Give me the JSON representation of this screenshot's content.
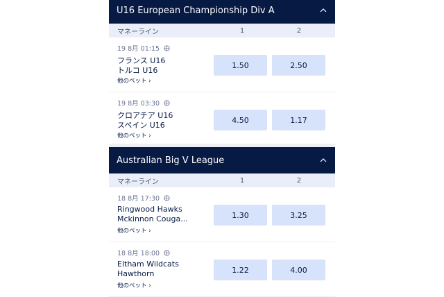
{
  "leagues": [
    {
      "title": "U16 European Championship Div A",
      "market_label": "マネーライン",
      "col1": "1",
      "col2": "2",
      "matches": [
        {
          "time": "19 8月 01:15",
          "team1": "フランス U16",
          "team2": "トルコ U16",
          "odd1": "1.50",
          "odd2": "2.50",
          "more": "他のベット ›"
        },
        {
          "time": "19 8月 03:30",
          "team1": "クロアチア U16",
          "team2": "スペイン U16",
          "odd1": "4.50",
          "odd2": "1.17",
          "more": "他のベット ›"
        }
      ]
    },
    {
      "title": "Australian Big V League",
      "market_label": "マネーライン",
      "col1": "1",
      "col2": "2",
      "matches": [
        {
          "time": "18 8月 17:30",
          "team1": "Ringwood Hawks",
          "team2": "Mckinnon Couga...",
          "odd1": "1.30",
          "odd2": "3.25",
          "more": "他のベット ›"
        },
        {
          "time": "18 8月 18:00",
          "team1": "Eltham Wildcats",
          "team2": "Hawthorn",
          "odd1": "1.22",
          "odd2": "4.00",
          "more": "他のベット ›"
        }
      ]
    }
  ],
  "icons": {
    "collapse": "chevron-up-icon",
    "sport": "basketball-icon"
  },
  "colors": {
    "header_bg": "#061a44",
    "odd_bg": "#d7e3fb",
    "subheader_bg": "#e9eef8"
  }
}
